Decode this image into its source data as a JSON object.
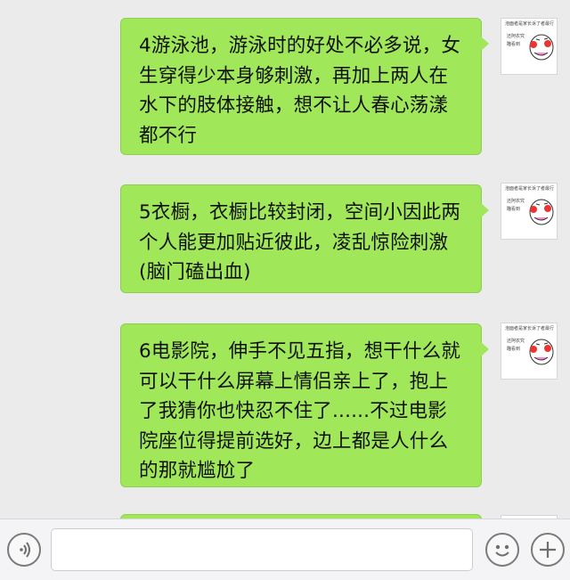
{
  "messages": [
    {
      "id": 4,
      "text": "4游泳池，游泳时的好处不必多说，女生穿得少本身够刺激，再加上两人在水下的肢体接触，想不让人春心荡漾都不行",
      "avatar": {
        "icon": "meme-face-avatar",
        "caption": "泡面者是家长诉了者最行",
        "line1": "还阿农究",
        "line2": "瞄看到"
      }
    },
    {
      "id": 5,
      "text": "5衣橱，衣橱比较封闭，空间小因此两个人能更加贴近彼此，凌乱惊险刺激(脑门磕出血)",
      "avatar": {
        "icon": "meme-face-avatar",
        "caption": "泡面者是家长诉了者最行",
        "line1": "还阿农究",
        "line2": "瞄看到"
      }
    },
    {
      "id": 6,
      "text": "6电影院，伸手不见五指，想干什么就可以干什么屏幕上情侣亲上了，抱上了我猜你也快忍不住了......不过电影院座位得提前选好，边上都是人什么的那就尴尬了",
      "avatar": {
        "icon": "meme-face-avatar",
        "caption": "泡面者是家长诉了者最行",
        "line1": "还阿农究",
        "line2": "瞄看到"
      }
    }
  ],
  "input_bar": {
    "voice_icon": "voice-icon",
    "text_value": "",
    "emoji_icon": "emoji-icon",
    "plus_icon": "plus-icon"
  },
  "colors": {
    "bubble": "#a0e75a",
    "background": "#ebebeb",
    "input_bar": "#f4f4f6"
  }
}
